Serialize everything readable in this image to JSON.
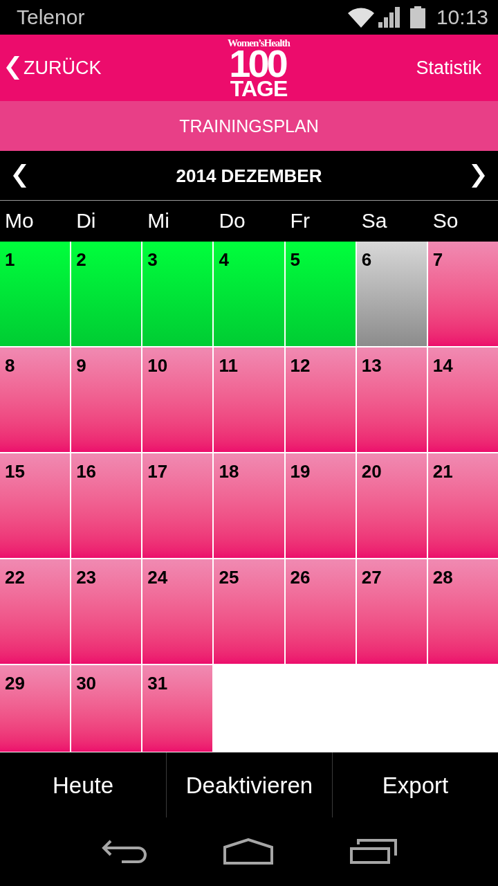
{
  "status_bar": {
    "carrier": "Telenor",
    "time": "10:13"
  },
  "header": {
    "back_label": "ZURÜCK",
    "logo": {
      "brand": "Women’sHealth",
      "number": "100",
      "word": "TAGE"
    },
    "right_label": "Statistik"
  },
  "subheader": {
    "title": "TRAININGSPLAN"
  },
  "calendar": {
    "month_title": "2014 DEZEMBER",
    "weekdays": [
      "Mo",
      "Di",
      "Mi",
      "Do",
      "Fr",
      "Sa",
      "So"
    ],
    "weeks": [
      {
        "days": [
          {
            "label": "1",
            "kind": "done"
          },
          {
            "label": "2",
            "kind": "done"
          },
          {
            "label": "3",
            "kind": "done"
          },
          {
            "label": "4",
            "kind": "done"
          },
          {
            "label": "5",
            "kind": "done"
          },
          {
            "label": "6",
            "kind": "missed"
          },
          {
            "label": "7",
            "kind": "open"
          }
        ]
      },
      {
        "days": [
          {
            "label": "8",
            "kind": "open"
          },
          {
            "label": "9",
            "kind": "open"
          },
          {
            "label": "10",
            "kind": "open"
          },
          {
            "label": "11",
            "kind": "open"
          },
          {
            "label": "12",
            "kind": "open"
          },
          {
            "label": "13",
            "kind": "open"
          },
          {
            "label": "14",
            "kind": "open"
          }
        ]
      },
      {
        "days": [
          {
            "label": "15",
            "kind": "open"
          },
          {
            "label": "16",
            "kind": "open"
          },
          {
            "label": "17",
            "kind": "open"
          },
          {
            "label": "18",
            "kind": "open"
          },
          {
            "label": "19",
            "kind": "open"
          },
          {
            "label": "20",
            "kind": "open"
          },
          {
            "label": "21",
            "kind": "open"
          }
        ]
      },
      {
        "days": [
          {
            "label": "22",
            "kind": "open"
          },
          {
            "label": "23",
            "kind": "open"
          },
          {
            "label": "24",
            "kind": "open"
          },
          {
            "label": "25",
            "kind": "open"
          },
          {
            "label": "26",
            "kind": "open"
          },
          {
            "label": "27",
            "kind": "open"
          },
          {
            "label": "28",
            "kind": "open"
          }
        ]
      },
      {
        "days": [
          {
            "label": "29",
            "kind": "open"
          },
          {
            "label": "30",
            "kind": "open"
          },
          {
            "label": "31",
            "kind": "open"
          }
        ]
      }
    ]
  },
  "bottom_bar": {
    "buttons": [
      "Heute",
      "Deaktivieren",
      "Export"
    ]
  }
}
